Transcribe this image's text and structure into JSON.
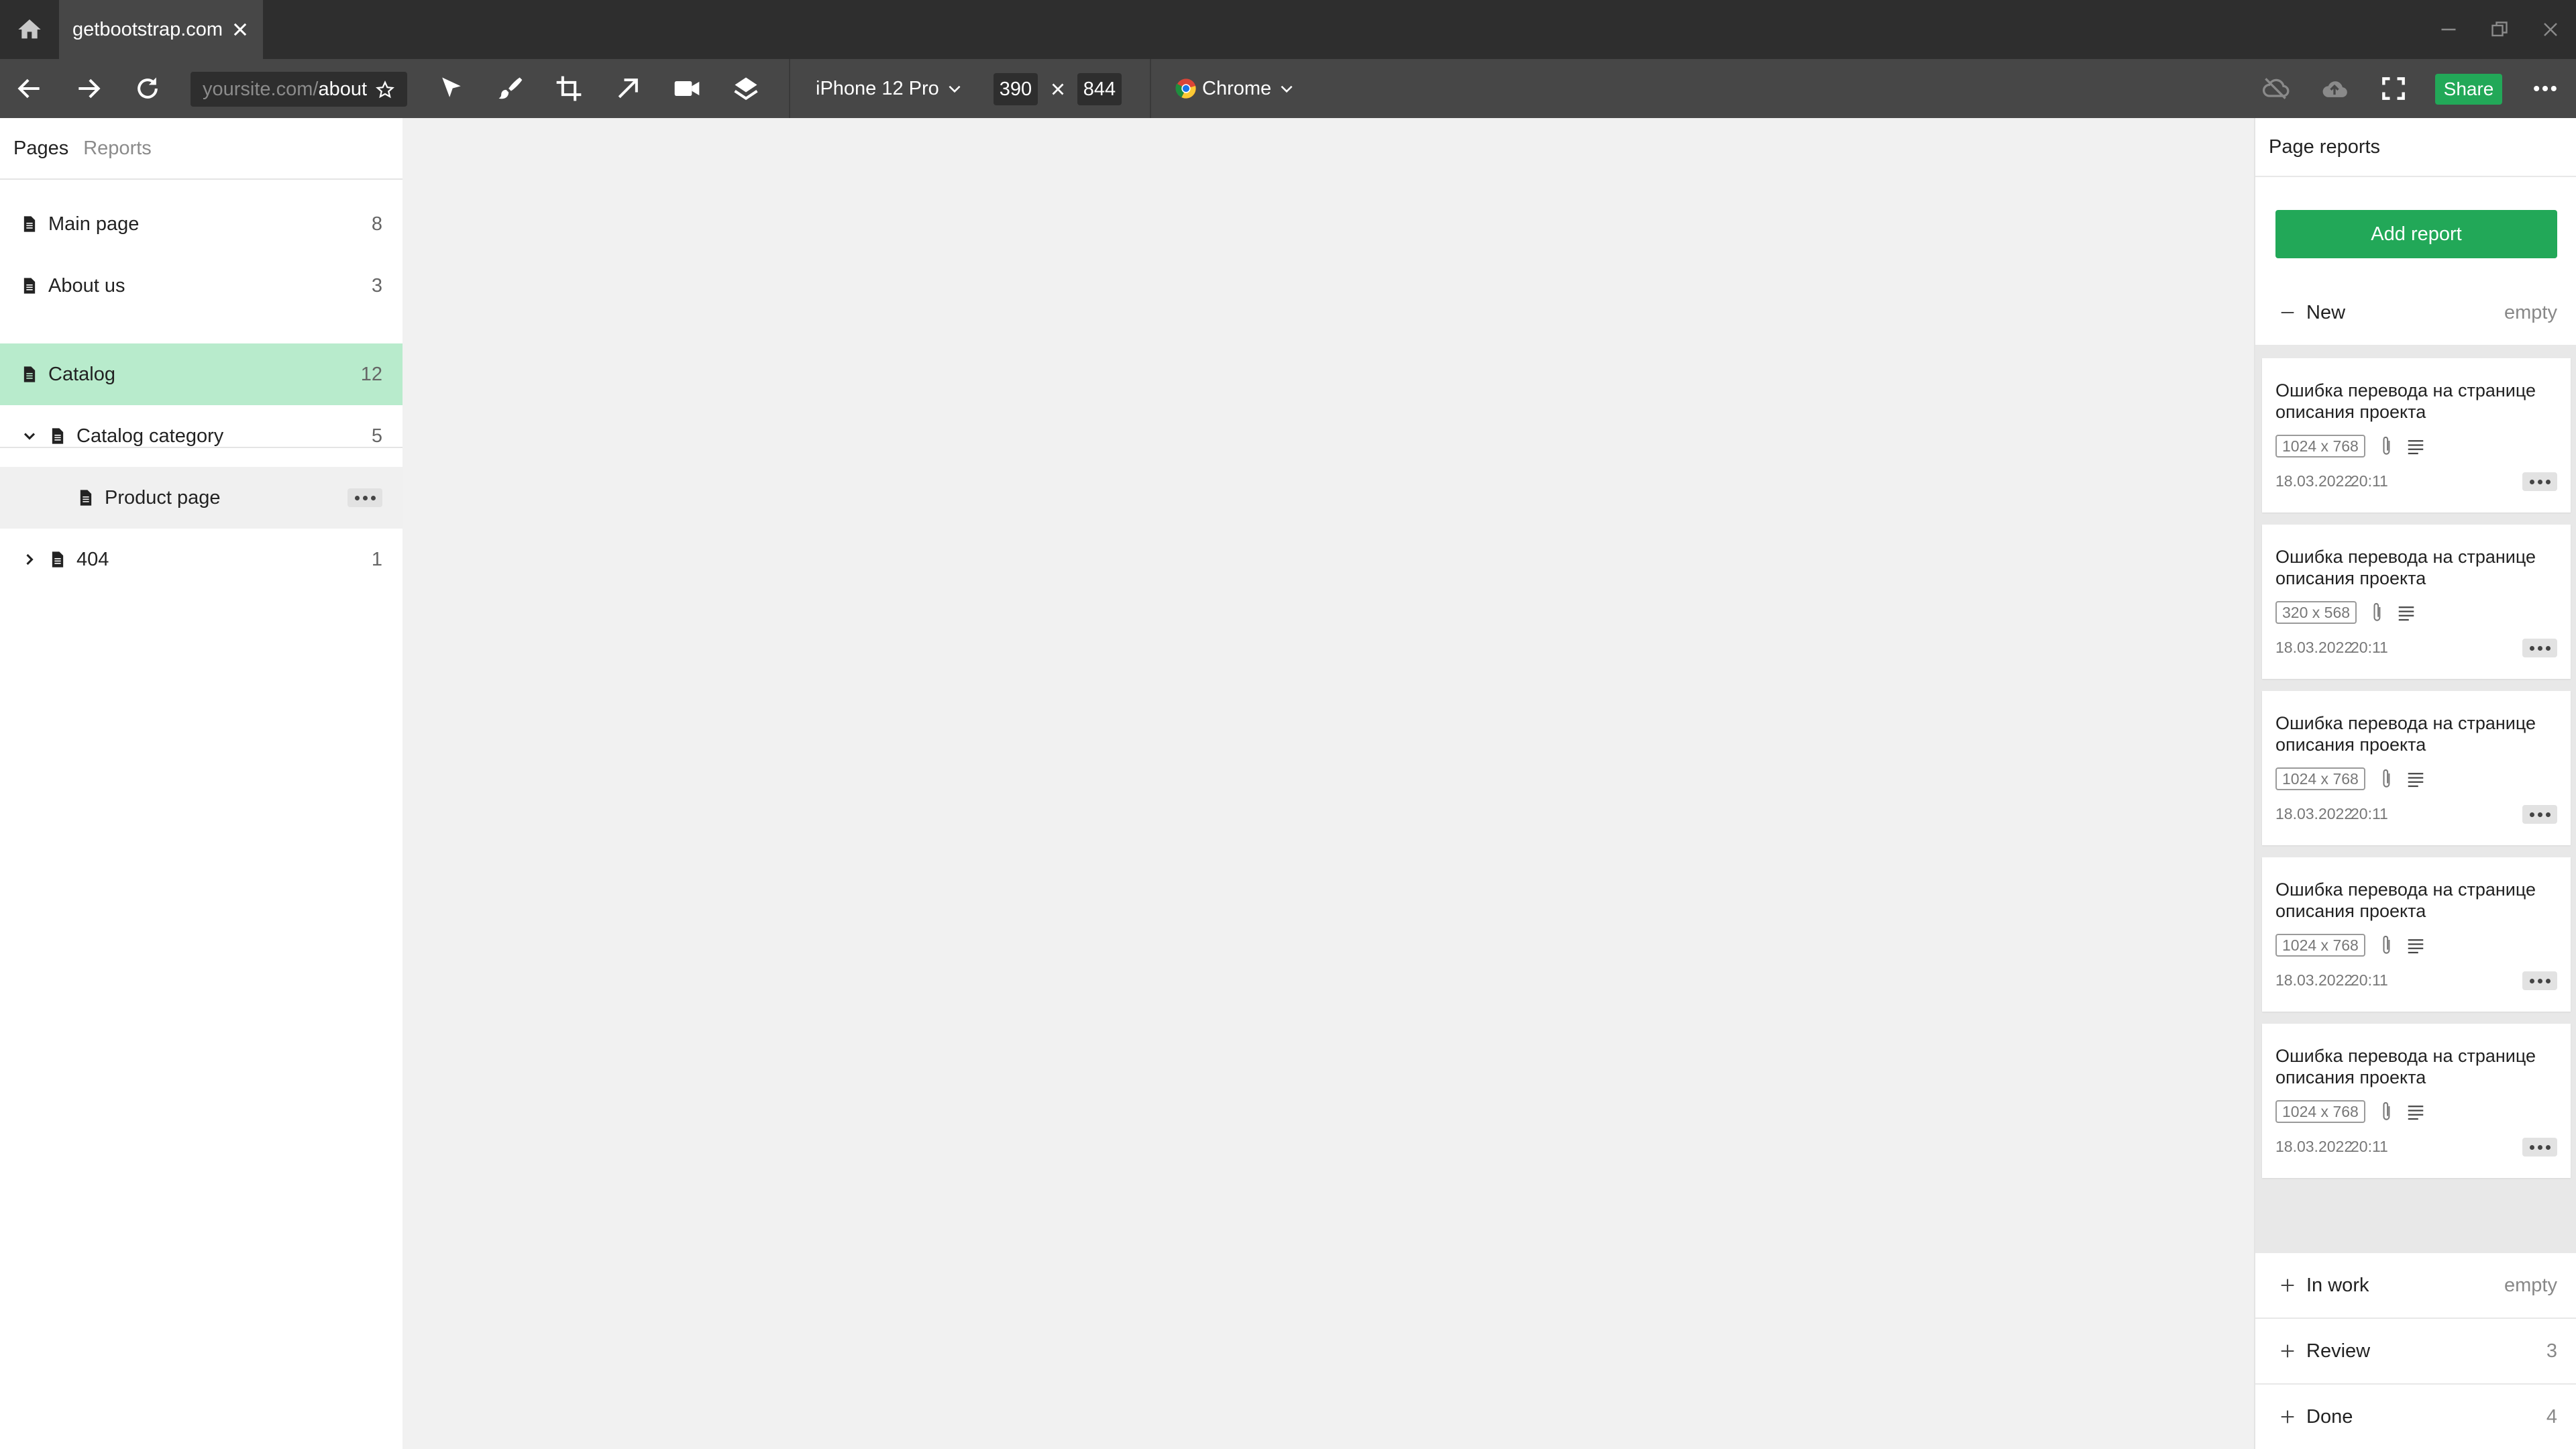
{
  "window": {
    "tab_title": "getbootstrap.com"
  },
  "toolbar": {
    "url_base": "yoursite.com/",
    "url_path": "about",
    "device": "iPhone 12 Pro",
    "width": "390",
    "height": "844",
    "browser": "Chrome",
    "share_label": "Share"
  },
  "sidebar": {
    "tabs": [
      "Pages",
      "Reports"
    ],
    "pages": [
      {
        "label": "Main page",
        "count": "8"
      },
      {
        "label": "About us",
        "count": "3"
      },
      {
        "label": "Catalog",
        "count": "12"
      },
      {
        "label": "Catalog category",
        "count": "5"
      },
      {
        "label": "Product page",
        "count": ""
      },
      {
        "label": "404",
        "count": "1"
      }
    ]
  },
  "reports_panel": {
    "title": "Page reports",
    "add_label": "Add report",
    "groups": [
      {
        "label": "New",
        "value": "empty"
      },
      {
        "label": "In work",
        "value": "empty"
      },
      {
        "label": "Review",
        "value": "3"
      },
      {
        "label": "Done",
        "value": "4"
      }
    ],
    "cards": [
      {
        "title": "Ошибка перевода на странице описания проекта",
        "resolution": "1024 x 768",
        "date": "18.03.2022",
        "time": "20:11"
      },
      {
        "title": "Ошибка перевода на странице описания проекта",
        "resolution": "320 x 568",
        "date": "18.03.2022",
        "time": "20:11"
      },
      {
        "title": "Ошибка перевода на странице описания проекта",
        "resolution": "1024 x 768",
        "date": "18.03.2022",
        "time": "20:11"
      },
      {
        "title": "Ошибка перевода на странице описания проекта",
        "resolution": "1024 x 768",
        "date": "18.03.2022",
        "time": "20:11"
      },
      {
        "title": "Ошибка перевода на странице описания проекта",
        "resolution": "1024 x 768",
        "date": "18.03.2022",
        "time": "20:11"
      }
    ]
  },
  "colors": {
    "accent_green": "#22a858",
    "selected_row": "#b8ebcc",
    "hover_row": "#f0f0f0"
  }
}
